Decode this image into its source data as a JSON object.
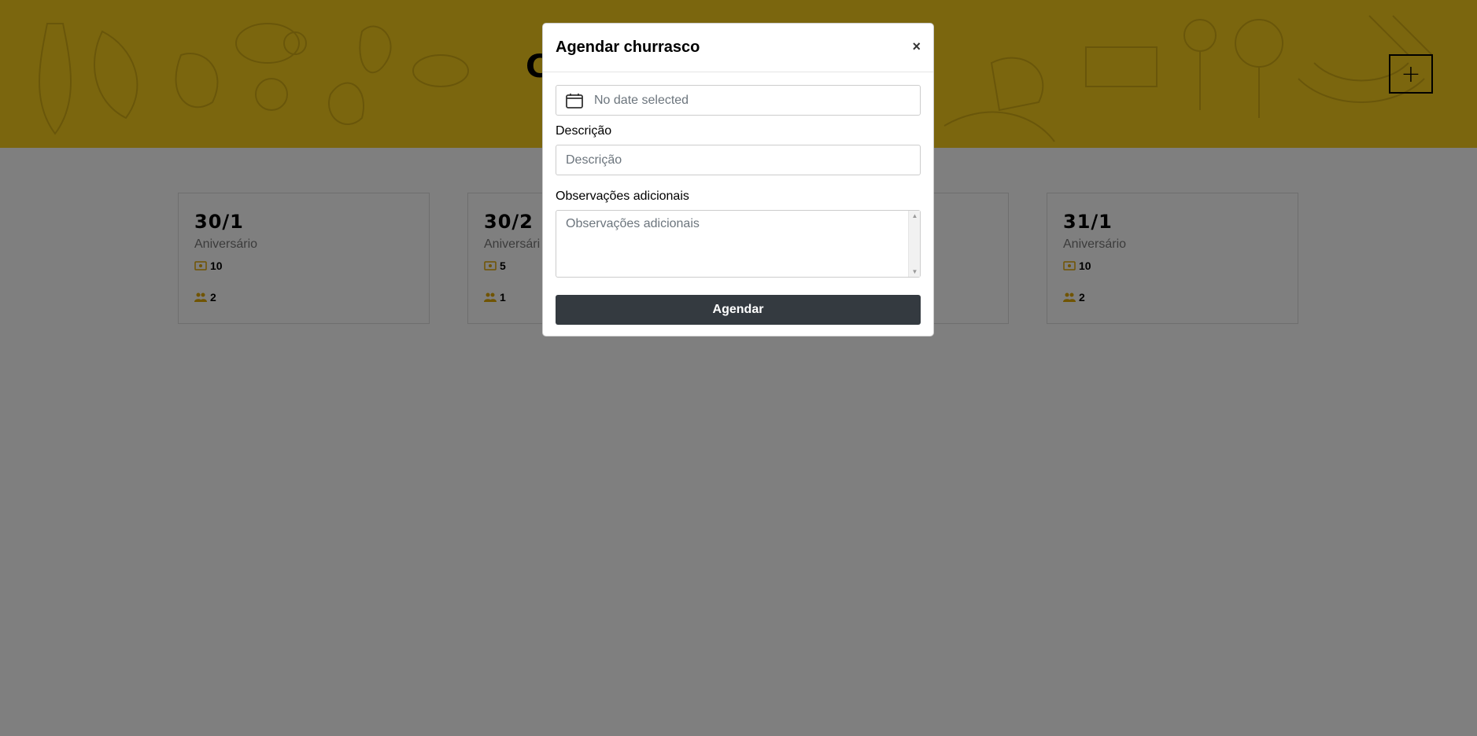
{
  "header": {
    "title_partial": "C",
    "add_label": "+"
  },
  "cards": [
    {
      "date": "30/1",
      "description": "Aniversário",
      "amount": "10",
      "people": "2"
    },
    {
      "date": "30/2",
      "description": "Aniversári",
      "amount": "5",
      "people": "1"
    },
    {
      "date": "31/1",
      "description": "Aniversário",
      "amount": "10",
      "people": "2"
    }
  ],
  "modal": {
    "title": "Agendar churrasco",
    "close_label": "×",
    "date_placeholder": "No date selected",
    "description_label": "Descrição",
    "description_placeholder": "Descrição",
    "notes_label": "Observações adicionais",
    "notes_placeholder": "Observações adicionais",
    "submit_label": "Agendar"
  },
  "colors": {
    "brand_yellow": "#f7cd1c",
    "icon_yellow": "#e0a800",
    "button_dark": "#343a40"
  }
}
